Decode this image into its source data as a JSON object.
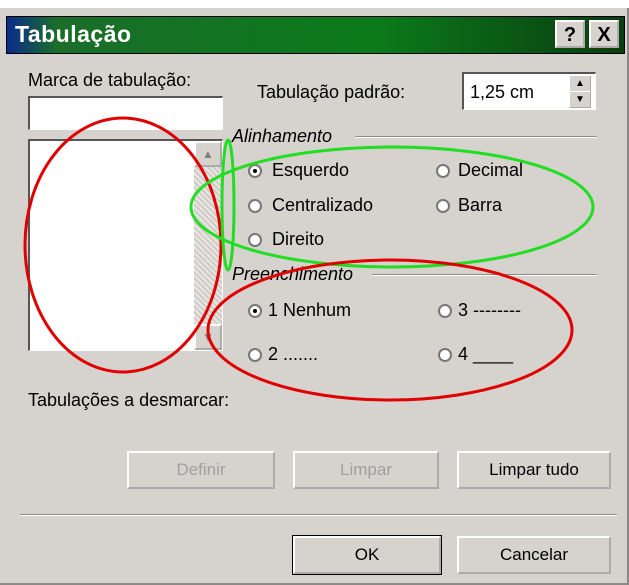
{
  "window": {
    "title": "Tabulação",
    "help_btn": "?",
    "close_btn": "X"
  },
  "tab_stop": {
    "label": "Marca de tabulação:",
    "value": ""
  },
  "default_tab": {
    "label": "Tabulação padrão:",
    "value": "1,25 cm"
  },
  "alignment": {
    "group_label": "Alinhamento",
    "options": [
      "Esquerdo",
      "Centralizado",
      "Direito",
      "Decimal",
      "Barra"
    ],
    "selected": "Esquerdo"
  },
  "leader": {
    "group_label": "Preenchimento",
    "options": [
      "1 Nenhum",
      "2 .......",
      "3 --------",
      "4 ____"
    ],
    "selected": "1 Nenhum"
  },
  "clear_label": "Tabulações a desmarcar:",
  "buttons": {
    "set": "Definir",
    "clear": "Limpar",
    "clear_all": "Limpar tudo",
    "ok": "OK",
    "cancel": "Cancelar"
  },
  "annotation_colors": {
    "red": "#e00000",
    "green": "#22dd22"
  }
}
